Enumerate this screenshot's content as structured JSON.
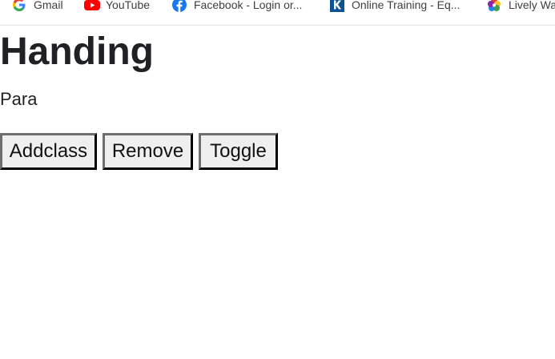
{
  "bookmarks": [
    {
      "label": "Gmail",
      "icon": "google-icon"
    },
    {
      "label": "YouTube",
      "icon": "youtube-icon"
    },
    {
      "label": "Facebook - Login or...",
      "icon": "facebook-icon"
    },
    {
      "label": "Online Training - Eq...",
      "icon": "k-icon"
    },
    {
      "label": "Lively Wa",
      "icon": "lively-icon"
    }
  ],
  "page": {
    "heading": "Handing",
    "paragraph": "Para"
  },
  "buttons": {
    "addclass": "Addclass",
    "remove": "Remove",
    "toggle": "Toggle"
  },
  "colors": {
    "youtube_red": "#ff0000",
    "facebook_blue": "#1877f2",
    "k_blue": "#0b5394",
    "button_bg": "#efefef",
    "text": "#202124"
  }
}
